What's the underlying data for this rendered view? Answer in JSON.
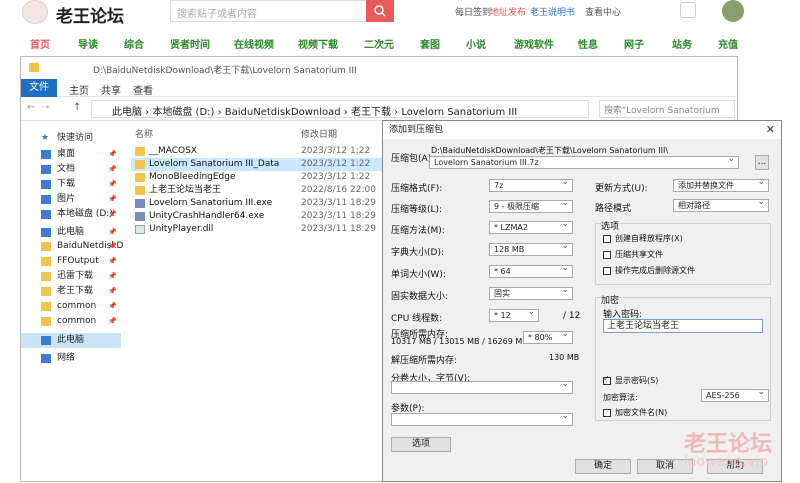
{
  "site": {
    "logo_text": "老王论坛",
    "search_placeholder": "搜索贴子或者内容",
    "top_links": [
      "每日签到",
      "地址发布",
      "老王说明书",
      "查看中心"
    ],
    "nav": [
      "首页",
      "导读",
      "综合",
      "贤者时间",
      "在线视频",
      "视频下载",
      "二次元",
      "套图",
      "小说",
      "游戏软件",
      "性息",
      "网子",
      "站务",
      "充值"
    ],
    "brand_color": "#e95a5a"
  },
  "explorer": {
    "title_path": "D:\\BaiduNetdiskDownload\\老王下载\\Lovelorn Sanatorium III",
    "ribbon_tabs": [
      "文件",
      "主页",
      "共享",
      "查看"
    ],
    "breadcrumb": [
      "此电脑",
      "本地磁盘 (D:)",
      "BaiduNetdiskDownload",
      "老王下载",
      "Lovelorn Sanatorium III"
    ],
    "search_placeholder": "搜索\"Lovelorn Sanatorium ...",
    "nav_items": [
      {
        "label": "快速访问",
        "icon": "star-icon"
      },
      {
        "label": "桌面",
        "icon": "desktop-icon"
      },
      {
        "label": "文档",
        "icon": "document-icon"
      },
      {
        "label": "下载",
        "icon": "download-icon"
      },
      {
        "label": "图片",
        "icon": "picture-icon"
      },
      {
        "label": "本地磁盘 (D:)",
        "icon": "drive-icon"
      },
      {
        "label": "此电脑",
        "icon": "computer-icon"
      },
      {
        "label": "BaiduNetdiskD",
        "icon": "folder-icon"
      },
      {
        "label": "FFOutput",
        "icon": "folder-icon"
      },
      {
        "label": "迅雷下载",
        "icon": "folder-icon"
      },
      {
        "label": "老王下载",
        "icon": "folder-icon"
      },
      {
        "label": "common",
        "icon": "folder-icon"
      },
      {
        "label": "common",
        "icon": "folder-icon"
      },
      {
        "label": "此电脑",
        "icon": "computer-icon"
      },
      {
        "label": "网络",
        "icon": "network-icon"
      }
    ],
    "columns": {
      "name": "名称",
      "date": "修改日期"
    },
    "files": [
      {
        "name": "__MACOSX",
        "date": "2023/3/12 1:22",
        "type": "folder"
      },
      {
        "name": "Lovelorn Sanatorium III_Data",
        "date": "2023/3/12 1:22",
        "type": "folder"
      },
      {
        "name": "MonoBleedingEdge",
        "date": "2023/3/12 1:22",
        "type": "folder"
      },
      {
        "name": "上老王论坛当老王",
        "date": "2022/8/16 22:00",
        "type": "folder"
      },
      {
        "name": "Lovelorn Sanatorium III.exe",
        "date": "2023/3/11 18:29",
        "type": "exe"
      },
      {
        "name": "UnityCrashHandler64.exe",
        "date": "2023/3/11 18:29",
        "type": "exe"
      },
      {
        "name": "UnityPlayer.dll",
        "date": "2023/3/11 18:29",
        "type": "dll"
      }
    ]
  },
  "dialog": {
    "title": "添加到压缩包",
    "archive_label": "压缩包(A)",
    "archive_path": "D:\\BaiduNetdiskDownload\\老王下载\\Lovelorn Sanatorium III\\",
    "archive_name": "Lovelorn Sanatorium III.7z",
    "browse_label": "...",
    "format_label": "压缩格式(F):",
    "format_value": "7z",
    "level_label": "压缩等级(L):",
    "level_value": "9 - 极限压缩",
    "method_label": "压缩方法(M):",
    "method_value": "* LZMA2",
    "dict_label": "字典大小(D):",
    "dict_value": "128 MB",
    "word_label": "单词大小(W):",
    "word_value": "* 64",
    "solid_label": "固实数据大小:",
    "solid_value": "固实",
    "threads_label": "CPU 线程数:",
    "threads_value": "* 12",
    "threads_max": "/ 12",
    "mem_label": "压缩所需内存:",
    "mem_value": "10317 MB / 13015 MB / 16269 MB",
    "mem_pct": "* 80%",
    "unmem_label": "解压缩所需内存:",
    "unmem_value": "130 MB",
    "split_label": "分卷大小，字节(V):",
    "params_label": "参数(P):",
    "options_button": "选项",
    "update_label": "更新方式(U):",
    "update_value": "添加并替换文件",
    "pathmode_label": "路径模式",
    "pathmode_value": "相对路径",
    "options_group": "选项",
    "opt_sfx": "创建自释放程序(X)",
    "opt_shared": "压缩共享文件",
    "opt_delete": "操作完成后删除源文件",
    "encrypt_group": "加密",
    "password_label": "输入密码:",
    "password_value": "上老王论坛当老王",
    "show_password": "显示密码(S)",
    "enc_method_label": "加密算法:",
    "enc_method_value": "AES-256",
    "enc_names": "加密文件名(N)",
    "ok": "确定",
    "cancel": "取消",
    "help": "帮助"
  },
  "watermark": {
    "text": "老王论坛",
    "sub": "laowang.vip"
  }
}
